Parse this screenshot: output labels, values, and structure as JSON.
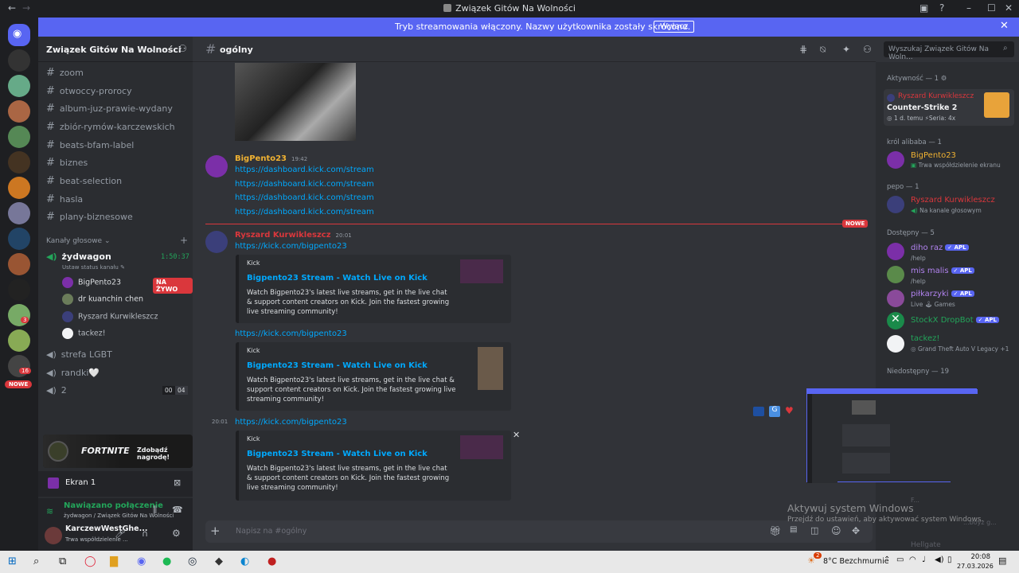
{
  "window": {
    "title": "Związek Gitów Na Wolności",
    "back_icon": "arrow-left",
    "forward_icon": "arrow-right"
  },
  "stream_banner": {
    "message": "Tryb streamowania włączony. Nazwy użytkownika zostały skrócone.",
    "button": "Wyłącz"
  },
  "server_list": {
    "badges": [
      "3",
      "16"
    ],
    "new_label": "NOWE"
  },
  "sidebar": {
    "guild_name": "Związek Gitów Na Wolności",
    "text_channels": [
      "zoom",
      "otwoccy-prorocy",
      "album-juz-prawie-wydany",
      "zbiór-rymów-karczewskich",
      "beats-bfam-label",
      "biznes",
      "beat-selection",
      "hasla",
      "plany-biznesowe"
    ],
    "voice_category": "Kanały głosowe",
    "voice_channel": {
      "name": "żydwagon",
      "timer": "1:50:37",
      "status_placeholder": "Ustaw status kanału"
    },
    "voice_users": [
      {
        "name": "BigPento23",
        "live": "NA ŻYWO"
      },
      {
        "name": "dr kuanchin chen"
      },
      {
        "name": "Ryszard Kurwikleszcz"
      },
      {
        "name": "tackez!"
      }
    ],
    "other_voice": [
      "strefa LGBT",
      "randki🤍",
      "2"
    ],
    "other_voice_counts": [
      "00",
      "04"
    ],
    "promo": {
      "game": "FORTNITE",
      "cta": "Zdobądź nagrodę!"
    },
    "screen_share": "Ekran 1",
    "connection": {
      "status": "Nawiązano połączenie",
      "detail": "żydwagon / Związek Gitów Na Wolności"
    },
    "user": {
      "name": "KarczewWestGhe...",
      "status": "Trwa współdzielenie ..."
    }
  },
  "chat": {
    "channel": "ogólny",
    "search_placeholder": "Wyszukaj Związek Gitów Na Woln...",
    "new_divider": "NOWE",
    "messages": [
      {
        "author": "BigPento23",
        "time": "19:42",
        "links": [
          "https://dashboard.kick.com/stream",
          "https://dashboard.kick.com/stream",
          "https://dashboard.kick.com/stream",
          "https://dashboard.kick.com/stream"
        ]
      },
      {
        "author": "Ryszard Kurwikleszcz",
        "time": "20:01",
        "link1": "https://kick.com/bigpento23",
        "embed1": {
          "provider": "Kick",
          "title": "Bigpento23 Stream - Watch Live on Kick",
          "desc": "Watch Bigpento23's latest live streams, get in the live chat & support content creators on Kick. Join the fastest growing live streaming community!"
        },
        "link2": "https://kick.com/bigpento23",
        "embed2": {
          "provider": "Kick",
          "title": "Bigpento23 Stream - Watch Live on Kick",
          "desc": "Watch Bigpento23's latest live streams, get in the live chat & support content creators on Kick. Join the fastest growing live streaming community!"
        },
        "time2": "20:01",
        "link3": "https://kick.com/bigpento23",
        "embed3": {
          "provider": "Kick",
          "title": "Bigpento23 Stream - Watch Live on Kick",
          "desc": "Watch Bigpento23's latest live streams, get in the live chat & support content creators on Kick. Join the fastest growing live streaming community!"
        }
      }
    ],
    "input_placeholder": "Napisz na #ogólny"
  },
  "members": {
    "groups": [
      {
        "header": "Aktywność — 1",
        "members": [
          {
            "name": "Ryszard Kurwikleszcz",
            "sub": "Counter-Strike 2",
            "sub2": "1 d. temu",
            "sub3": "Seria: 4x"
          }
        ]
      },
      {
        "header": "król alibaba — 1",
        "members": [
          {
            "name": "BigPento23",
            "sub": "Trwa współdzielenie ekranu"
          }
        ]
      },
      {
        "header": "pepo — 1",
        "members": [
          {
            "name": "Ryszard Kurwikleszcz",
            "sub": "Na kanale głosowym"
          }
        ]
      },
      {
        "header": "Dostępny — 5",
        "members": [
          {
            "name": "diho raz",
            "tag": "APL",
            "sub": "/help"
          },
          {
            "name": "mis malis",
            "tag": "APL",
            "sub": "/help"
          },
          {
            "name": "piłkarzyki",
            "tag": "APL",
            "sub": "Live 🕹 Games"
          },
          {
            "name": "StockX DropBot",
            "tag": "APL",
            "sub": ""
          },
          {
            "name": "tackez!",
            "sub": "Grand Theft Auto V Legacy +1"
          }
        ]
      },
      {
        "header": "Niedostępny — 19",
        "members": []
      }
    ],
    "faded": [
      "F...",
      "...boyz g...",
      "Hellgate"
    ]
  },
  "overlay": {
    "activate_title": "Aktywuj system Windows",
    "activate_sub": "Przejdź do ustawień, aby aktywować system Windows."
  },
  "taskbar": {
    "weather": "8°C Bezchmurnie",
    "weather_badge": "2",
    "time": "20:08",
    "date": "27.03.2026"
  },
  "colors": {
    "accent": "#5865f2",
    "link": "#00a8fc",
    "red": "#da373c",
    "yellow_name": "#f0b232",
    "green": "#23a55a"
  }
}
